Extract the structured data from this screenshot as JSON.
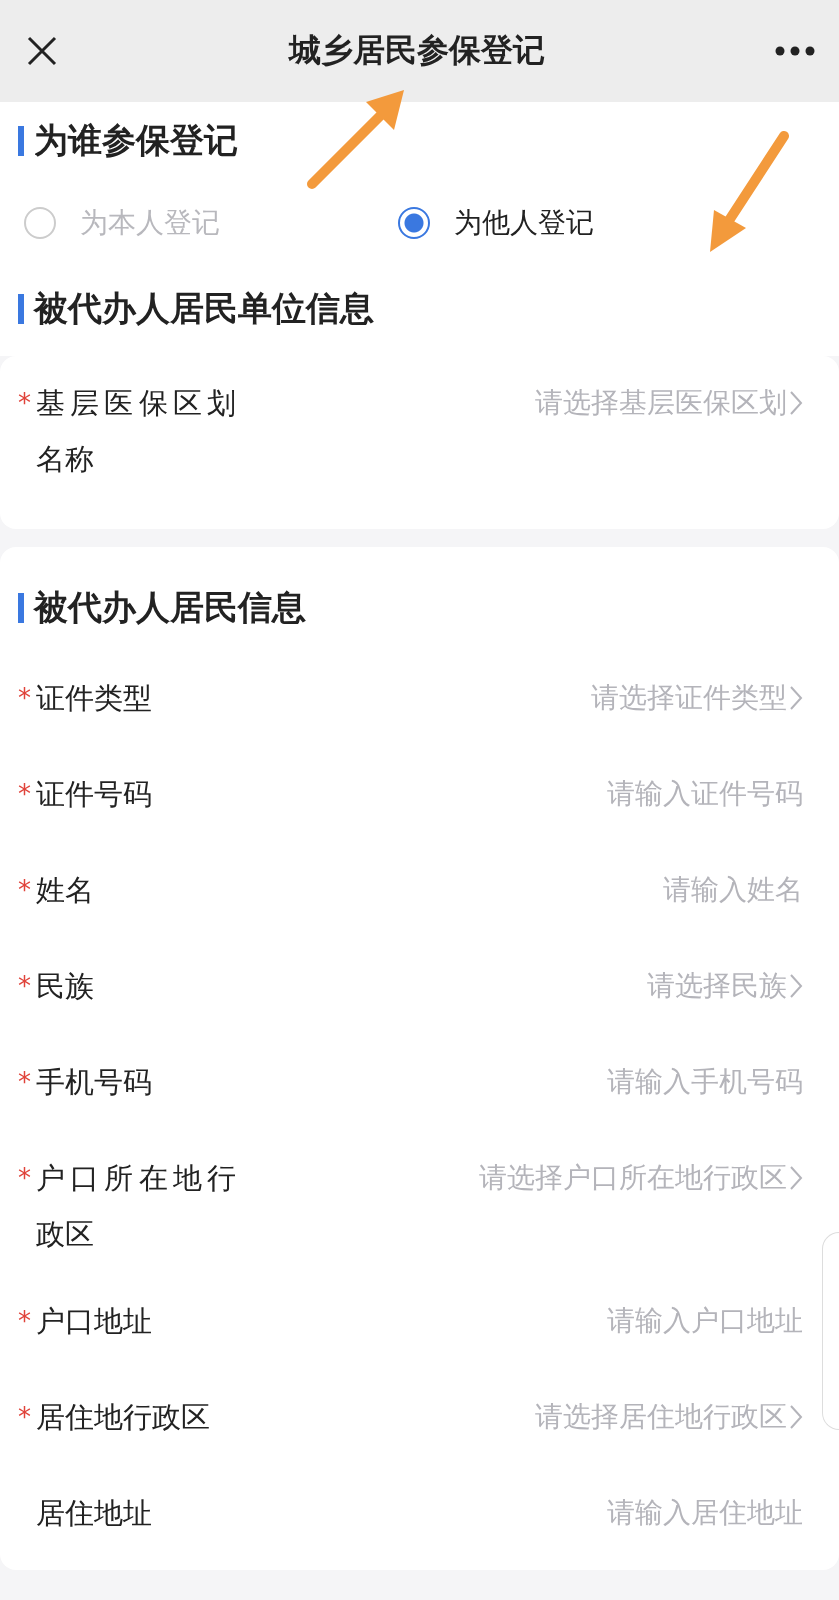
{
  "header": {
    "title": "城乡居民参保登记"
  },
  "who": {
    "heading": "为谁参保登记",
    "options": [
      {
        "label": "为本人登记",
        "selected": false
      },
      {
        "label": "为他人登记",
        "selected": true
      }
    ]
  },
  "unit_section": {
    "heading": "被代办人居民单位信息",
    "fields": [
      {
        "label": "基层医保区划名称",
        "required_mark": "*",
        "kind": "select",
        "placeholder": "请选择基层医保区划"
      }
    ]
  },
  "resident_card": {
    "heading": "被代办人居民信息",
    "fields": [
      {
        "label": "证件类型",
        "required_mark": "*",
        "kind": "select",
        "placeholder": "请选择证件类型"
      },
      {
        "label": "证件号码",
        "required_mark": "*",
        "kind": "input",
        "placeholder": "请输入证件号码"
      },
      {
        "label": "姓名",
        "required_mark": "*",
        "kind": "input",
        "placeholder": "请输入姓名"
      },
      {
        "label": "民族",
        "required_mark": "*",
        "kind": "select",
        "placeholder": "请选择民族"
      },
      {
        "label": "手机号码",
        "required_mark": "*",
        "kind": "input",
        "placeholder": "请输入手机号码"
      },
      {
        "label": "户口所在地行政区",
        "required_mark": "*",
        "kind": "select",
        "placeholder": "请选择户口所在地行政区"
      },
      {
        "label": "户口地址",
        "required_mark": "*",
        "kind": "input",
        "placeholder": "请输入户口地址"
      },
      {
        "label": "居住地行政区",
        "required_mark": "*",
        "kind": "select",
        "placeholder": "请选择居住地行政区"
      },
      {
        "label": "居住地址",
        "kind": "input",
        "placeholder": "请输入居住地址"
      }
    ]
  }
}
